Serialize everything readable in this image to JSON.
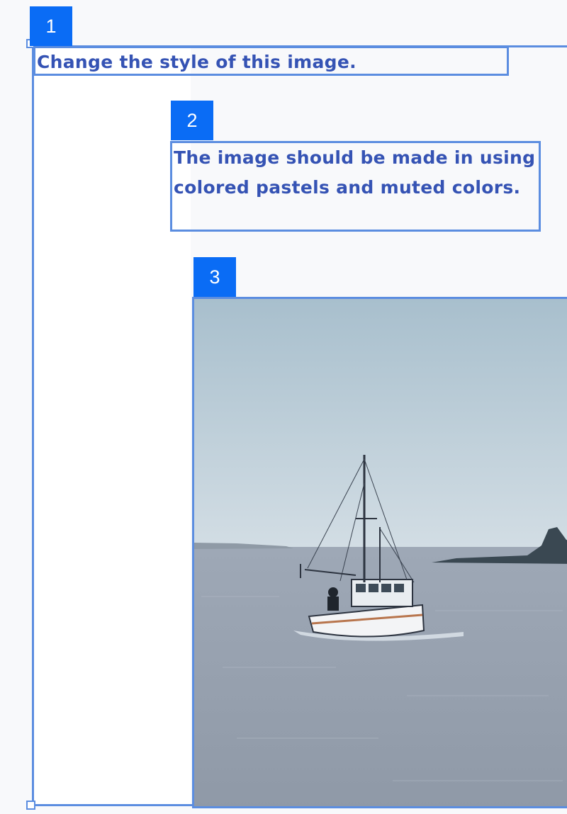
{
  "annotations": [
    {
      "number": "1",
      "text": "Change the style of this image."
    },
    {
      "number": "2",
      "text": "The image should be made in using colored pastels and muted colors."
    },
    {
      "number": "3"
    }
  ],
  "image": {
    "subject": "fishing boat on calm sea",
    "colors": {
      "sky_top": "#a8bfcd",
      "sky_bottom": "#d2dde4",
      "sea_top": "#9ea8b6",
      "sea_bottom": "#8f99a7",
      "accent": "#5b8de0",
      "badge": "#0a6cf5"
    }
  }
}
